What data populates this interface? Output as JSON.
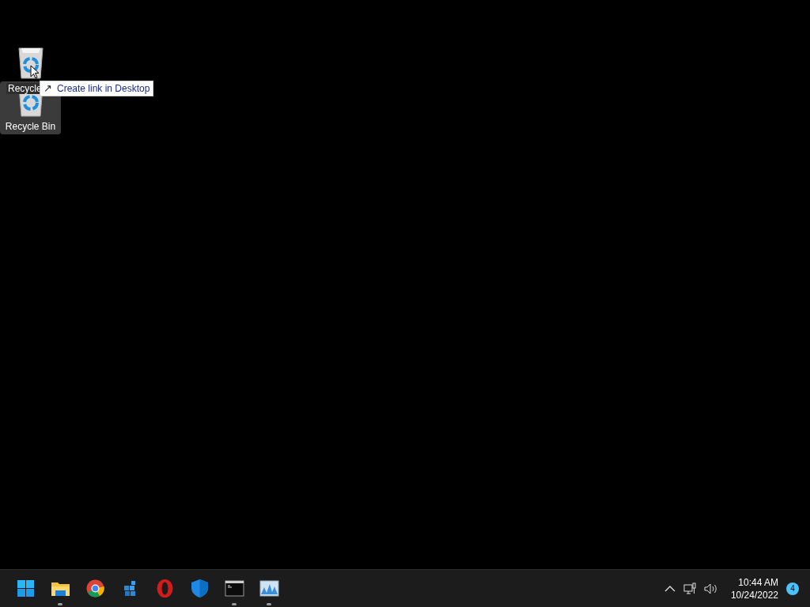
{
  "desktop_icons": [
    {
      "label": "Recycle",
      "selected": false
    },
    {
      "label": "Recycle Bin",
      "selected": true
    }
  ],
  "drag_tooltip": {
    "icon": "↗",
    "text": "Create link in Desktop"
  },
  "taskbar": {
    "apps": [
      {
        "kind": "start",
        "running": false
      },
      {
        "kind": "folder",
        "running": true
      },
      {
        "kind": "chrome",
        "running": false
      },
      {
        "kind": "cubes",
        "running": false
      },
      {
        "kind": "opera",
        "running": false
      },
      {
        "kind": "shield",
        "running": false
      },
      {
        "kind": "terminal",
        "running": true
      },
      {
        "kind": "monitor",
        "running": true
      }
    ]
  },
  "tray": {
    "time": "10:44 AM",
    "date": "10/24/2022",
    "notifications": "4"
  }
}
